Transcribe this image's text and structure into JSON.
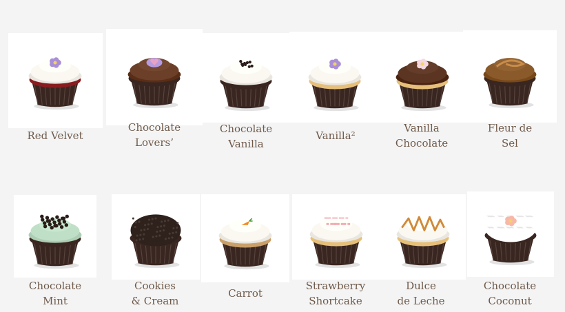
{
  "cupcakes": [
    {
      "name_line1": "Red Velvet",
      "name_line2": "",
      "cake_color": "#8a1c20",
      "frosting_color": "#fbf8f2",
      "topping": "flower",
      "topping_color": "#a98fd6"
    },
    {
      "name_line1": "Chocolate",
      "name_line2": "Lovers’",
      "cake_color": "#3a2620",
      "frosting_color": "#6b3f28",
      "topping": "heart",
      "topping_color": "#b69be0"
    },
    {
      "name_line1": "Chocolate",
      "name_line2": "Vanilla",
      "cake_color": "#3a2620",
      "frosting_color": "#fbf8f2",
      "topping": "crumbs",
      "topping_color": "#2a1d19"
    },
    {
      "name_line1": "Vanilla²",
      "name_line2": "",
      "cake_color": "#e6c07a",
      "frosting_color": "#fbf8f2",
      "topping": "flower",
      "topping_color": "#a98fd6"
    },
    {
      "name_line1": "Vanilla",
      "name_line2": "Chocolate",
      "cake_color": "#e6c07a",
      "frosting_color": "#5b3522",
      "topping": "flower",
      "topping_color": "#f5d7e0"
    },
    {
      "name_line1": "Fleur de",
      "name_line2": "Sel",
      "cake_color": "#3a2620",
      "frosting_color": "#8a5a2b",
      "topping": "swirl",
      "topping_color": "#c98d4a"
    },
    {
      "name_line1": "Chocolate",
      "name_line2": "Mint",
      "cake_color": "#3a2620",
      "frosting_color": "#bfe0c6",
      "topping": "chips",
      "topping_color": "#2a1d19"
    },
    {
      "name_line1": "Cookies",
      "name_line2": "& Cream",
      "cake_color": "#3a2620",
      "frosting_color": "#2f211c",
      "topping": "none",
      "topping_color": "#2f211c"
    },
    {
      "name_line1": "Carrot",
      "name_line2": "",
      "cake_color": "#caa06a",
      "frosting_color": "#fbf8f2",
      "topping": "carrot",
      "topping_color": "#f2891f"
    },
    {
      "name_line1": "Strawberry",
      "name_line2": "Shortcake",
      "cake_color": "#e6c07a",
      "frosting_color": "#fbf8f2",
      "topping": "sprinkles",
      "topping_color": "#f3a7b0"
    },
    {
      "name_line1": "Dulce",
      "name_line2": "de Leche",
      "cake_color": "#e6c07a",
      "frosting_color": "#fbf8f2",
      "topping": "drizzle",
      "topping_color": "#d08a3a"
    },
    {
      "name_line1": "Chocolate",
      "name_line2": "Coconut",
      "cake_color": "#3a2620",
      "frosting_color": "#ffffff",
      "topping": "coconut",
      "topping_color": "#f7b8a8"
    }
  ],
  "colors": {
    "label_text": "#6f5a4a",
    "page_background": "#f4f4f4",
    "card_background": "#ffffff",
    "liner_color": "#3a2620"
  }
}
